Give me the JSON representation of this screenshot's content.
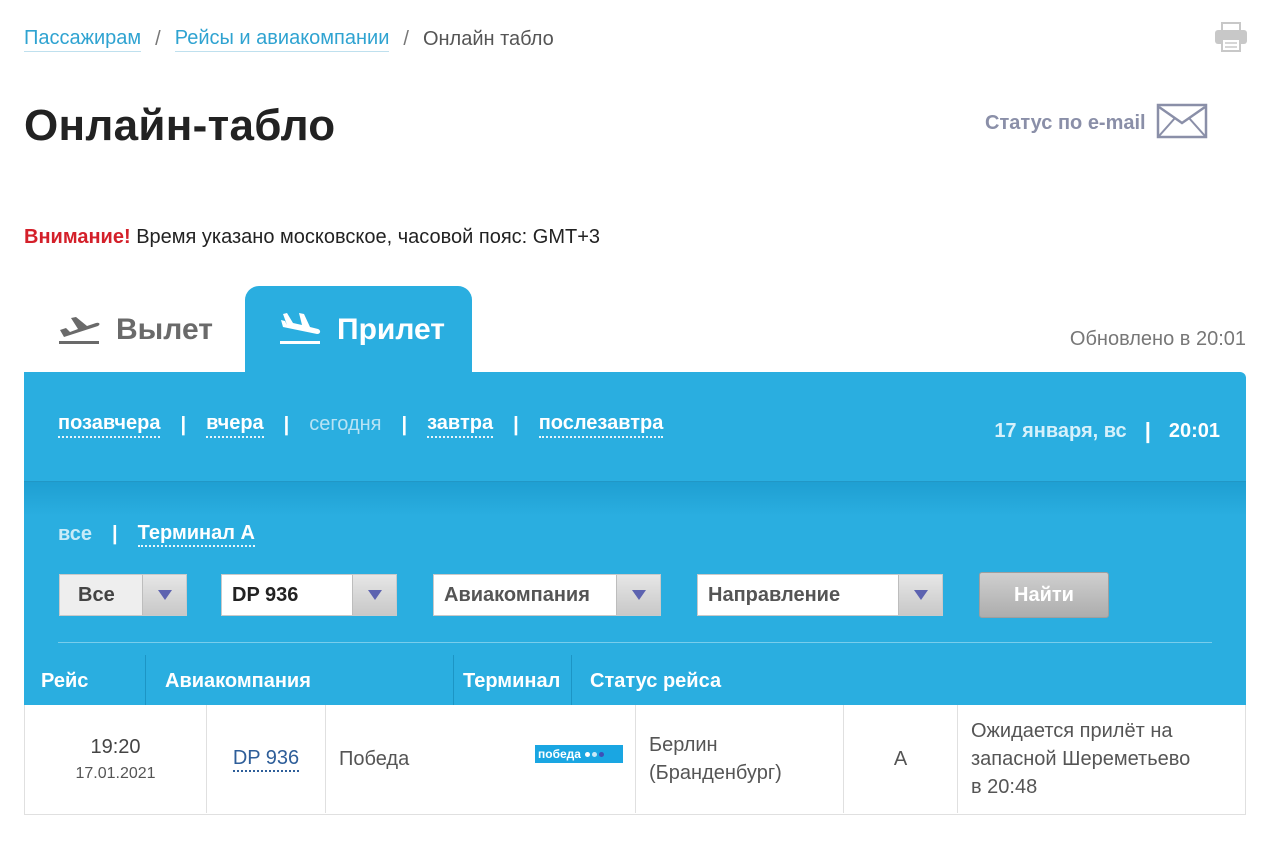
{
  "breadcrumb": {
    "items": [
      "Пассажирам",
      "Рейсы и авиакомпании"
    ],
    "separator": "/",
    "current": "Онлайн табло"
  },
  "page_title": "Онлайн-табло",
  "email_status_label": "Статус по e-mail",
  "notice": {
    "warning": "Внимание!",
    "text": "Время указано московское, часовой пояс: GMT+3"
  },
  "tabs": {
    "departure": "Вылет",
    "arrival": "Прилет",
    "active": "arrival"
  },
  "updated": "Обновлено в 20:01",
  "days": {
    "day_before_yesterday": "позавчера",
    "yesterday": "вчера",
    "today": "сегодня",
    "tomorrow": "завтра",
    "day_after_tomorrow": "послезавтра",
    "active": "today"
  },
  "current_date": "17 января, вс",
  "current_time": "20:01",
  "terminal_filter": {
    "all": "все",
    "terminal_a": "Терминал А"
  },
  "filters": {
    "terminal_value": "Все",
    "flight_value": "DP 936",
    "airline_placeholder": "Авиакомпания",
    "direction_placeholder": "Направление",
    "find_label": "Найти"
  },
  "columns": {
    "flight": "Рейс",
    "airline": "Авиакомпания",
    "terminal": "Терминал",
    "status": "Статус рейса"
  },
  "flights": [
    {
      "time": "19:20",
      "date": "17.01.2021",
      "flight": "DP 936",
      "airline": "Победа",
      "airline_logo_text": "победа",
      "city": "Берлин\n(Бранденбург)",
      "terminal": "A",
      "status": "Ожидается прилёт на\nзапасной Шереметьево\nв 20:48"
    }
  ],
  "colors": {
    "accent": "#2aaee0",
    "link": "#2fa3d1",
    "warning": "#d4202a",
    "flight_link": "#2e5e99"
  },
  "icons": {
    "print": "printer-icon",
    "email": "envelope-icon",
    "departure": "plane-takeoff-icon",
    "arrival": "plane-landing-icon",
    "dropdown": "triangle-down-icon"
  }
}
